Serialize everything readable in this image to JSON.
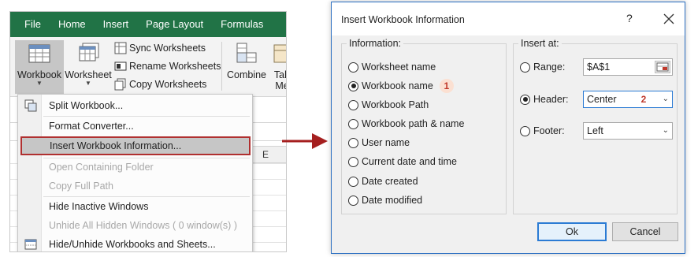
{
  "ribbon": {
    "tabs": [
      "File",
      "Home",
      "Insert",
      "Page Layout",
      "Formulas"
    ],
    "workbook_label": "Workbook",
    "worksheet_label": "Worksheet",
    "sync_label": "Sync Worksheets",
    "rename_label": "Rename Worksheets",
    "copy_label": "Copy Worksheets",
    "combine_label": "Combine",
    "table_label_line1": "Tab",
    "table_label_line2": "Me"
  },
  "grid": {
    "column_e": "E"
  },
  "menu": {
    "items": [
      {
        "label": "Split Workbook...",
        "icon": "split-workbook-icon",
        "enabled": true
      },
      {
        "label": "Format Converter...",
        "icon": "",
        "enabled": true
      },
      {
        "label": "Insert Workbook Information...",
        "icon": "",
        "enabled": true,
        "selected": true
      },
      {
        "label": "Open Containing Folder",
        "icon": "",
        "enabled": false
      },
      {
        "label": "Copy Full Path",
        "icon": "",
        "enabled": false
      },
      {
        "label": "Hide Inactive Windows",
        "icon": "",
        "enabled": true
      },
      {
        "label": "Unhide All Hidden Windows ( 0 window(s) )",
        "icon": "",
        "enabled": false
      },
      {
        "label": "Hide/Unhide Workbooks and Sheets...",
        "icon": "hide-unhide-icon",
        "enabled": true
      }
    ]
  },
  "dialog": {
    "title": "Insert Workbook Information",
    "help": "?",
    "information_title": "Information:",
    "information_options": [
      {
        "label": "Worksheet name",
        "checked": false
      },
      {
        "label": "Workbook name",
        "checked": true,
        "badge": "1"
      },
      {
        "label": "Workbook Path",
        "checked": false
      },
      {
        "label": "Workbook path & name",
        "checked": false
      },
      {
        "label": "User name",
        "checked": false
      },
      {
        "label": "Current date and time",
        "checked": false
      },
      {
        "label": "Date created",
        "checked": false
      },
      {
        "label": "Date modified",
        "checked": false
      }
    ],
    "insert_title": "Insert at:",
    "range_label": "Range:",
    "range_value": "$A$1",
    "header_label": "Header:",
    "header_value": "Center",
    "header_badge": "2",
    "footer_label": "Footer:",
    "footer_value": "Left",
    "ok_label": "Ok",
    "cancel_label": "Cancel"
  },
  "colors": {
    "excel_green": "#217346",
    "highlight_border": "#b03030",
    "arrow": "#a51f1f",
    "badge_text": "#c0392b",
    "dialog_border": "#2b6fc2"
  }
}
